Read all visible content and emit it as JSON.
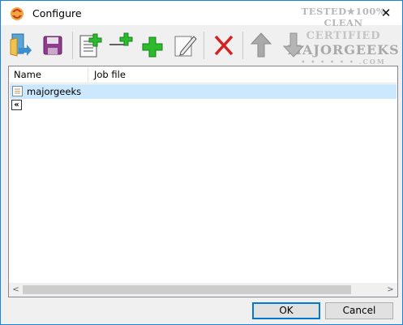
{
  "window": {
    "title": "Configure",
    "close_glyph": "✕"
  },
  "watermark": {
    "line1": "TESTED★100% CLEAN",
    "line2": "CERTIFIED",
    "line3": "MAJORGEEKS",
    "line4": "• • • • • • .COM"
  },
  "toolbar": {
    "buttons": [
      {
        "name": "open-icon"
      },
      {
        "name": "save-icon"
      },
      {
        "name": "new-job-icon"
      },
      {
        "name": "add-line-icon"
      },
      {
        "name": "add-icon"
      },
      {
        "name": "edit-icon"
      },
      {
        "name": "delete-icon"
      },
      {
        "name": "move-up-icon"
      },
      {
        "name": "move-down-icon"
      }
    ]
  },
  "list": {
    "columns": [
      "Name",
      "Job file"
    ],
    "rows": [
      {
        "name": "majorgeeks",
        "job_file": ""
      }
    ],
    "back_glyph": "«"
  },
  "scrollbar": {
    "left_arrow": "<",
    "right_arrow": ">"
  },
  "buttons": {
    "ok": "OK",
    "cancel": "Cancel"
  },
  "colors": {
    "selection": "#cce8ff",
    "accent": "#0078d7",
    "add_green": "#2dbb2d",
    "delete_red": "#d42020"
  }
}
